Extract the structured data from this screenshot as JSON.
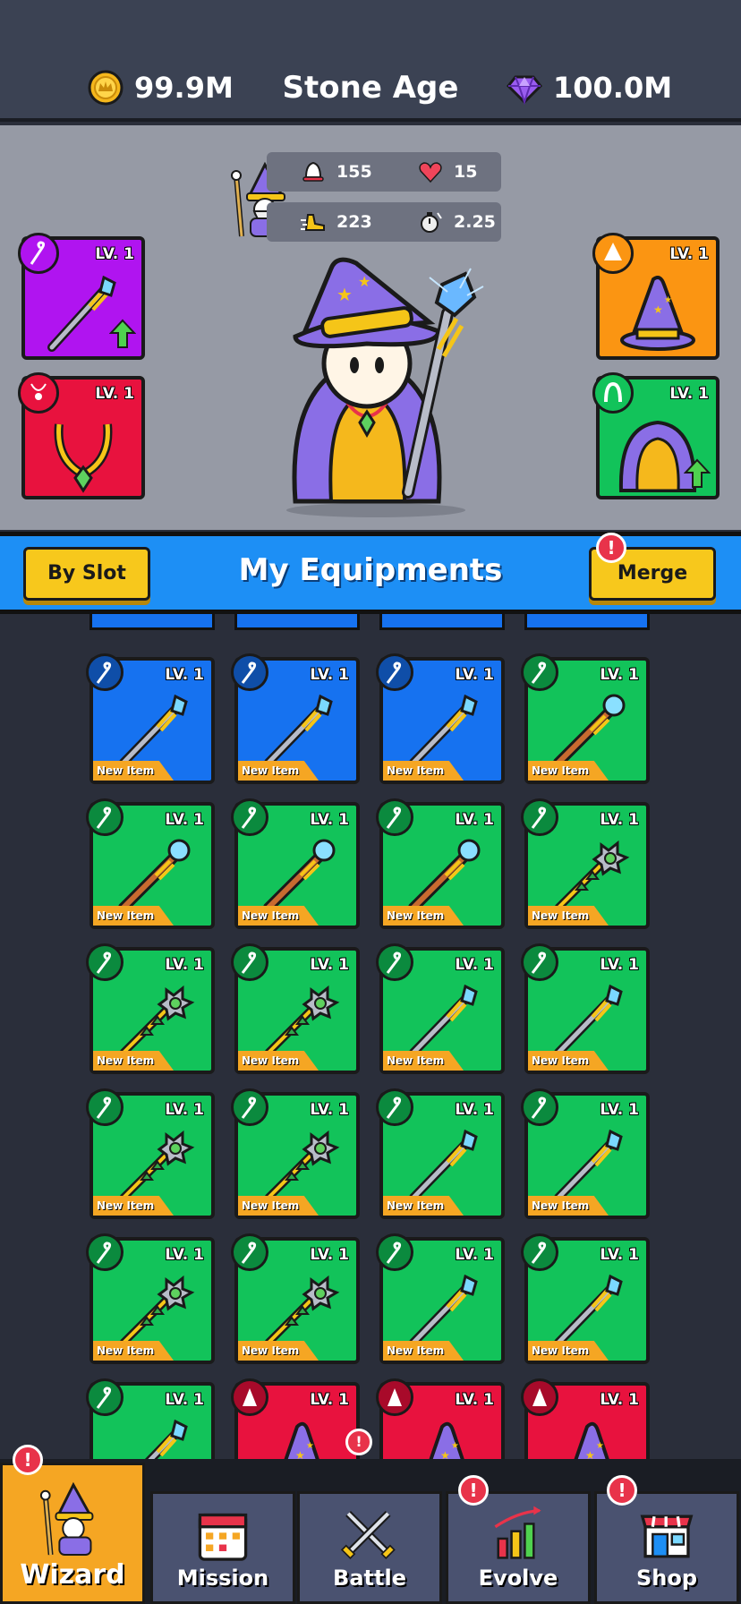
{
  "header": {
    "coins": "99.9M",
    "era": "Stone Age",
    "gems": "100.0M"
  },
  "stats": {
    "attack": "155",
    "health": "15",
    "speed": "223",
    "cooldown": "2.25"
  },
  "slots": [
    {
      "level": "LV. 1",
      "type": "staff",
      "color": "#b014f0"
    },
    {
      "level": "LV. 1",
      "type": "amulet",
      "color": "#e8123e"
    },
    {
      "level": "LV. 1",
      "type": "hat",
      "color": "#fb9512"
    },
    {
      "level": "LV. 1",
      "type": "cloak",
      "color": "#12c35a"
    }
  ],
  "equipment": {
    "title": "My Equipments",
    "by_slot": "By Slot",
    "merge": "Merge",
    "merge_alert": "!",
    "strip_label": "New Item",
    "items": [
      {
        "level": "LV. 1",
        "tag": "New Item",
        "rarity": "blue",
        "icon": "crystal-staff"
      },
      {
        "level": "LV. 1",
        "tag": "New Item",
        "rarity": "blue",
        "icon": "crystal-staff"
      },
      {
        "level": "LV. 1",
        "tag": "New Item",
        "rarity": "blue",
        "icon": "crystal-staff"
      },
      {
        "level": "LV. 1",
        "tag": "New Item",
        "rarity": "green",
        "icon": "orb-staff"
      },
      {
        "level": "LV. 1",
        "tag": "New Item",
        "rarity": "green",
        "icon": "orb-staff"
      },
      {
        "level": "LV. 1",
        "tag": "New Item",
        "rarity": "green",
        "icon": "orb-staff"
      },
      {
        "level": "LV. 1",
        "tag": "New Item",
        "rarity": "green",
        "icon": "orb-staff"
      },
      {
        "level": "LV. 1",
        "tag": "New Item",
        "rarity": "green",
        "icon": "mace-staff"
      },
      {
        "level": "LV. 1",
        "tag": "New Item",
        "rarity": "green",
        "icon": "mace-staff"
      },
      {
        "level": "LV. 1",
        "tag": "New Item",
        "rarity": "green",
        "icon": "mace-staff"
      },
      {
        "level": "LV. 1",
        "tag": "New Item",
        "rarity": "green",
        "icon": "crystal-staff"
      },
      {
        "level": "LV. 1",
        "tag": "New Item",
        "rarity": "green",
        "icon": "crystal-staff"
      },
      {
        "level": "LV. 1",
        "tag": "New Item",
        "rarity": "green",
        "icon": "mace-staff"
      },
      {
        "level": "LV. 1",
        "tag": "New Item",
        "rarity": "green",
        "icon": "mace-staff"
      },
      {
        "level": "LV. 1",
        "tag": "New Item",
        "rarity": "green",
        "icon": "crystal-staff"
      },
      {
        "level": "LV. 1",
        "tag": "New Item",
        "rarity": "green",
        "icon": "crystal-staff"
      },
      {
        "level": "LV. 1",
        "tag": "New Item",
        "rarity": "green",
        "icon": "mace-staff"
      },
      {
        "level": "LV. 1",
        "tag": "New Item",
        "rarity": "green",
        "icon": "mace-staff"
      },
      {
        "level": "LV. 1",
        "tag": "New Item",
        "rarity": "green",
        "icon": "crystal-staff"
      },
      {
        "level": "LV. 1",
        "tag": "New Item",
        "rarity": "green",
        "icon": "crystal-staff"
      },
      {
        "level": "LV. 1",
        "tag": "",
        "rarity": "green",
        "icon": "crystal-staff"
      },
      {
        "level": "LV. 1",
        "tag": "",
        "rarity": "red",
        "icon": "wizard-hat"
      },
      {
        "level": "LV. 1",
        "tag": "",
        "rarity": "red",
        "icon": "wizard-hat"
      },
      {
        "level": "LV. 1",
        "tag": "",
        "rarity": "red",
        "icon": "wizard-hat"
      }
    ]
  },
  "nav": {
    "tabs": [
      {
        "label": "Wizard",
        "icon": "wizard-icon",
        "active": true,
        "alert": "!"
      },
      {
        "label": "Mission",
        "icon": "calendar-icon",
        "active": false,
        "alert": ""
      },
      {
        "label": "Battle",
        "icon": "swords-icon",
        "active": false,
        "alert": ""
      },
      {
        "label": "Evolve",
        "icon": "chart-icon",
        "active": false,
        "alert": "!"
      },
      {
        "label": "Shop",
        "icon": "shop-icon",
        "active": false,
        "alert": "!"
      }
    ]
  }
}
